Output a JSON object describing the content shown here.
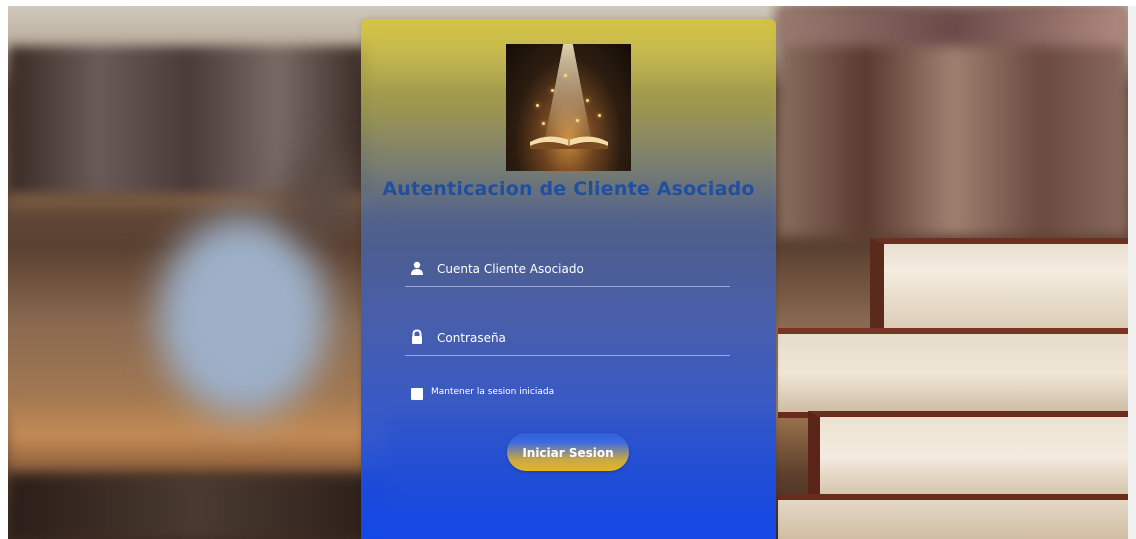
{
  "card": {
    "title": "Autenticacion de Cliente Asociado",
    "logo_icon": "glowing-book-icon"
  },
  "form": {
    "username": {
      "placeholder": "Cuenta Cliente Asociado",
      "value": "",
      "icon": "user-icon"
    },
    "password": {
      "placeholder": "Contraseña",
      "value": "",
      "icon": "lock-icon"
    },
    "remember": {
      "label": "Mantener la sesion iniciada",
      "checked": false
    },
    "submit_label": "Iniciar Sesion"
  },
  "colors": {
    "title": "#1f4f9e",
    "card_top": "#d6c43a",
    "card_bottom": "#1448eb",
    "button_gold": "#e0b628",
    "button_blue": "#2f5ee0"
  }
}
